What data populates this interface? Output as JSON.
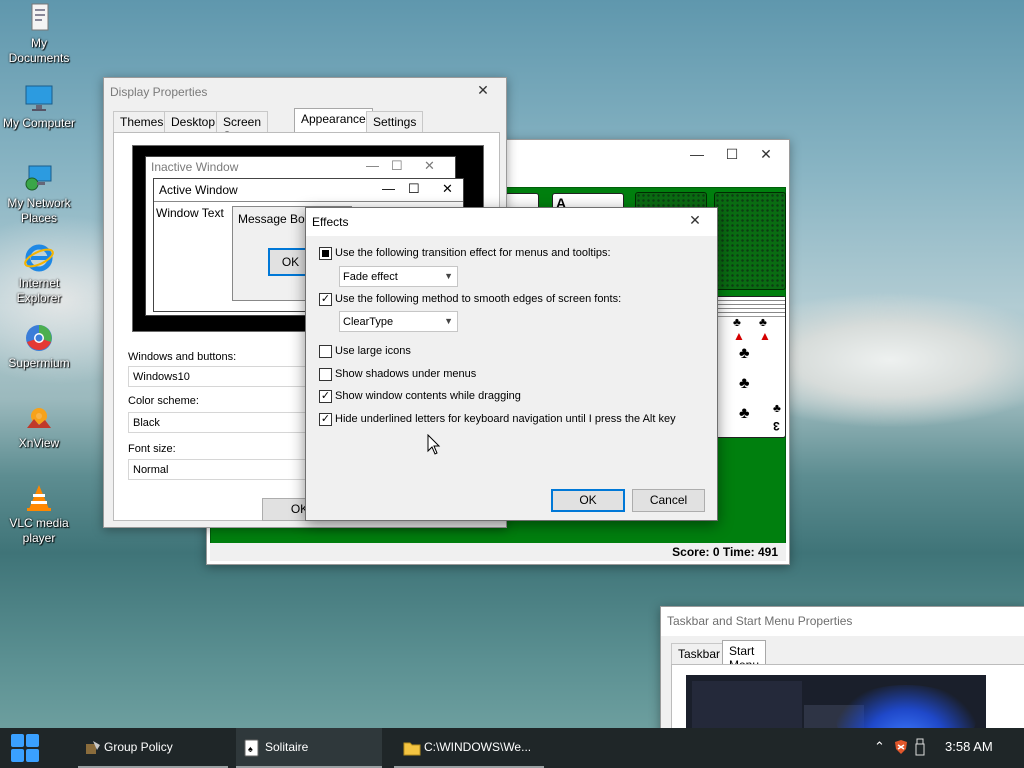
{
  "desktop": {
    "icons": [
      {
        "label": "My Documents",
        "icon": "my-documents-icon"
      },
      {
        "label": "My Computer",
        "icon": "monitor-icon"
      },
      {
        "label": "My Network Places",
        "icon": "network-icon"
      },
      {
        "label": "Internet Explorer",
        "icon": "internet-explorer-icon"
      },
      {
        "label": "Supermium",
        "icon": "supermium-icon"
      },
      {
        "label": "XnView",
        "icon": "xnview-icon"
      },
      {
        "label": "VLC media player",
        "icon": "vlc-icon"
      }
    ]
  },
  "display_properties": {
    "title": "Display Properties",
    "tabs": [
      "Themes",
      "Desktop",
      "Screen Saver",
      "Appearance",
      "Settings"
    ],
    "active_tab": "Appearance",
    "preview": {
      "inactive_title": "Inactive Window",
      "active_title": "Active Window",
      "window_text": "Window Text",
      "message_box_title": "Message Box",
      "ok_label": "OK"
    },
    "windows_and_buttons_label": "Windows and buttons:",
    "windows_and_buttons_value": "Windows10",
    "color_scheme_label": "Color scheme:",
    "color_scheme_value": "Black",
    "font_size_label": "Font size:",
    "font_size_value": "Normal",
    "ok_label": "OK"
  },
  "solitaire": {
    "score_text": "Score: 0 Time: 491",
    "foundation_card": "A"
  },
  "effects": {
    "title": "Effects",
    "options": [
      {
        "label": "Use the following transition effect for menus and tooltips:",
        "state": "indeterminate"
      },
      {
        "label": "Use the following method to smooth edges of screen fonts:",
        "state": "checked"
      },
      {
        "label": "Use large icons",
        "state": "unchecked"
      },
      {
        "label": "Show shadows under menus",
        "state": "unchecked"
      },
      {
        "label": "Show window contents while dragging",
        "state": "checked"
      },
      {
        "label": "Hide underlined letters for keyboard navigation until I press the Alt key",
        "state": "checked"
      }
    ],
    "transition_effect_value": "Fade effect",
    "smoothing_method_value": "ClearType",
    "ok_label": "OK",
    "cancel_label": "Cancel"
  },
  "taskbar_properties": {
    "title": "Taskbar and Start Menu Properties",
    "tabs": [
      "Taskbar",
      "Start Menu"
    ],
    "active_tab": "Start Menu"
  },
  "taskbar": {
    "items": [
      {
        "label": "Group Policy",
        "icon": "group-policy-icon"
      },
      {
        "label": "Solitaire",
        "icon": "solitaire-icon"
      },
      {
        "label": "C:\\WINDOWS\\We...",
        "icon": "folder-icon"
      }
    ],
    "clock": "3:58 AM"
  }
}
